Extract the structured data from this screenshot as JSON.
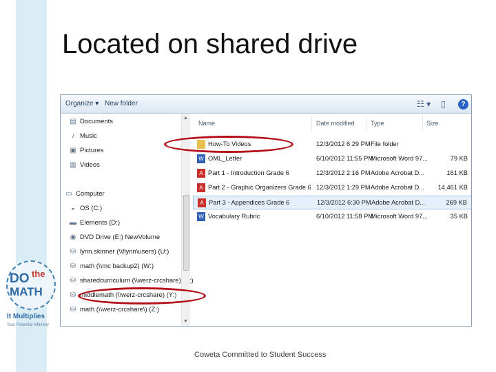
{
  "slide": {
    "title": "Located on shared drive",
    "footer": "Coweta Committed to Student Success"
  },
  "explorer": {
    "toolbar": {
      "organize": "Organize ▾",
      "new_folder": "New folder",
      "icons": [
        "view-options-icon",
        "preview-pane-icon",
        "help-icon"
      ]
    },
    "nav": {
      "items": [
        {
          "label": "Documents",
          "icon": "documents-icon"
        },
        {
          "label": "Music",
          "icon": "music-icon"
        },
        {
          "label": "Pictures",
          "icon": "pictures-icon"
        },
        {
          "label": "Videos",
          "icon": "videos-icon"
        },
        {
          "label": "Computer",
          "icon": "computer-icon"
        },
        {
          "label": "OS (C:)",
          "icon": "drive-icon"
        },
        {
          "label": "Elements (D:)",
          "icon": "drive-icon"
        },
        {
          "label": "DVD Drive (E:) NewVolume",
          "icon": "dvd-icon"
        },
        {
          "label": "lynn.skinner (\\\\flynn\\users) (U:)",
          "icon": "network-drive-icon"
        },
        {
          "label": "math (\\\\mc backup2) (W:)",
          "icon": "network-drive-icon"
        },
        {
          "label": "sharedcurriculum (\\\\werz-crcshare) (X:)",
          "icon": "network-drive-icon"
        },
        {
          "label": "middlemath (\\\\werz-crcshare) (Y:)",
          "icon": "network-drive-icon"
        },
        {
          "label": "math (\\\\werz-crcshare\\) (Z:)",
          "icon": "network-drive-icon"
        }
      ]
    },
    "columns": {
      "name": "Name",
      "date": "Date modified",
      "type": "Type",
      "size": "Size"
    },
    "files": [
      {
        "name": "How-To Videos",
        "date": "12/3/2012 6:29 PM",
        "type": "File folder",
        "size": "",
        "kind": "folder"
      },
      {
        "name": "OML_Letter",
        "date": "6/10/2012 11:55 PM",
        "type": "Microsoft Word 97...",
        "size": "79 KB",
        "kind": "word"
      },
      {
        "name": "Part 1 - Introduction Grade 6",
        "date": "12/3/2012 2:16 PM",
        "type": "Adobe Acrobat D...",
        "size": "161 KB",
        "kind": "pdf"
      },
      {
        "name": "Part 2 - Graphic Organizers Grade 6",
        "date": "12/3/2012 1:29 PM",
        "type": "Adobe Acrobat D...",
        "size": "14,461 KB",
        "kind": "pdf"
      },
      {
        "name": "Part 3 - Appendices Grade 6",
        "date": "12/3/2012 6:30 PM",
        "type": "Adobe Acrobat D...",
        "size": "269 KB",
        "kind": "pdf",
        "selected": true
      },
      {
        "name": "Vocabulary Rubric",
        "date": "6/10/2012 11:58 PM",
        "type": "Microsoft Word 97...",
        "size": "35 KB",
        "kind": "word"
      }
    ]
  },
  "logo": {
    "line1": "DO",
    "line2": "the",
    "line3": "MATH",
    "tagline": "It Multiplies",
    "sub": "Your Potential Infinitely"
  },
  "annotation_color": "#b40e18"
}
